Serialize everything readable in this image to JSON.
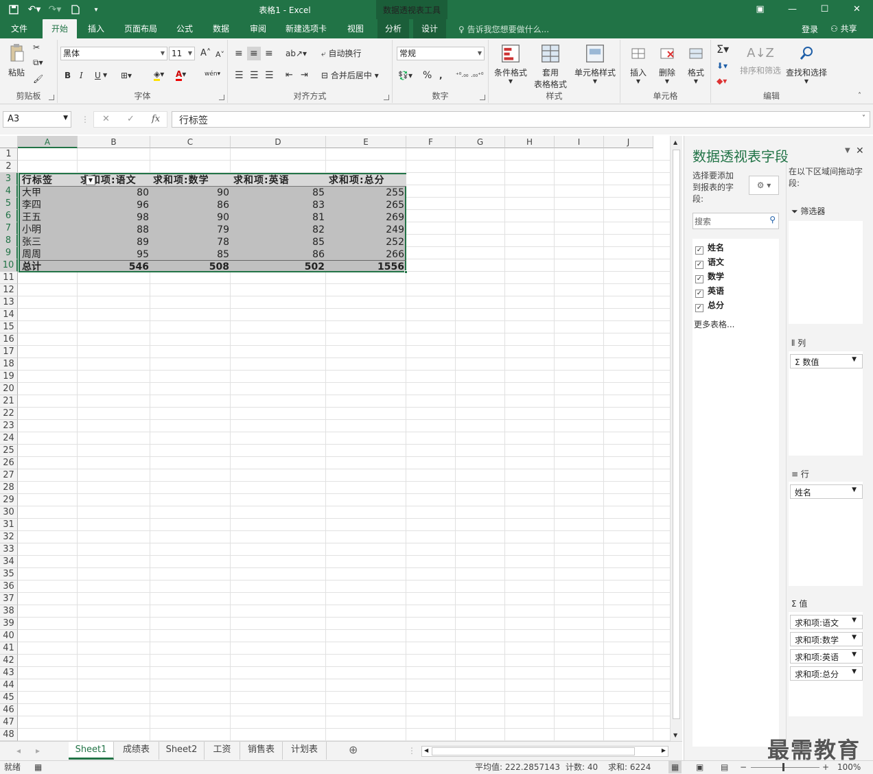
{
  "title": {
    "doc": "表格1 - Excel",
    "context_tools": "数据透视表工具"
  },
  "tabs": [
    "文件",
    "开始",
    "插入",
    "页面布局",
    "公式",
    "数据",
    "审阅",
    "新建选项卡",
    "视图",
    "分析",
    "设计"
  ],
  "tell_me": "告诉我您想要做什么...",
  "login": "登录",
  "share": "共享",
  "ribbon": {
    "clipboard": {
      "paste": "粘贴",
      "label": "剪贴板"
    },
    "font": {
      "name": "黑体",
      "size": "11",
      "label": "字体",
      "bold": "B",
      "italic": "I",
      "underline": "U",
      "grow": "A",
      "shrink": "A",
      "color_a": "A",
      "wen": "wén"
    },
    "align": {
      "wrap": "自动换行",
      "merge": "合并后居中",
      "label": "对齐方式"
    },
    "number": {
      "format": "常规",
      "percent": "%",
      "comma": ",",
      "label": "数字"
    },
    "styles": {
      "cond": "条件格式",
      "table1": "套用",
      "table2": "表格格式",
      "cell": "单元格样式",
      "label": "样式"
    },
    "cells": {
      "insert": "插入",
      "delete": "删除",
      "format": "格式",
      "label": "单元格"
    },
    "editing": {
      "sort": "排序和筛选",
      "find": "查找和选择",
      "label": "编辑"
    }
  },
  "formula": {
    "cell_ref": "A3",
    "content": "行标签",
    "fx": "fx"
  },
  "columns": [
    "A",
    "B",
    "C",
    "D",
    "E",
    "F",
    "G",
    "H",
    "I",
    "J"
  ],
  "pivot": {
    "headers": [
      "行标签",
      "求和项:语文",
      "求和项:数学",
      "求和项:英语",
      "求和项:总分"
    ],
    "rows": [
      [
        "大甲",
        "80",
        "90",
        "85",
        "255"
      ],
      [
        "李四",
        "96",
        "86",
        "83",
        "265"
      ],
      [
        "王五",
        "98",
        "90",
        "81",
        "269"
      ],
      [
        "小明",
        "88",
        "79",
        "82",
        "249"
      ],
      [
        "张三",
        "89",
        "78",
        "85",
        "252"
      ],
      [
        "周周",
        "95",
        "85",
        "86",
        "266"
      ]
    ],
    "total": [
      "总计",
      "546",
      "508",
      "502",
      "1556"
    ]
  },
  "sheets": [
    "Sheet1",
    "成绩表",
    "Sheet2",
    "工资",
    "销售表",
    "计划表"
  ],
  "status": {
    "ready": "就绪",
    "average": "平均值: 222.2857143",
    "count": "计数: 40",
    "sum": "求和: 6224",
    "zoom": "100%"
  },
  "pane": {
    "title": "数据透视表字段",
    "choose": "选择要添加到报表的字段:",
    "drag": "在以下区域间拖动字段:",
    "search": "搜索",
    "fields": [
      "姓名",
      "语文",
      "数学",
      "英语",
      "总分"
    ],
    "more": "更多表格...",
    "filter_label": "筛选器",
    "columns_label": "列",
    "rows_label": "行",
    "values_label": "值",
    "columns_items": [
      "数值"
    ],
    "rows_items": [
      "姓名"
    ],
    "values_items": [
      "求和项:语文",
      "求和项:数学",
      "求和项:英语",
      "求和项:总分"
    ]
  },
  "watermark": "最需教育",
  "colors": {
    "accent": "#217346",
    "pivot_fill": "#c0c0c0"
  }
}
